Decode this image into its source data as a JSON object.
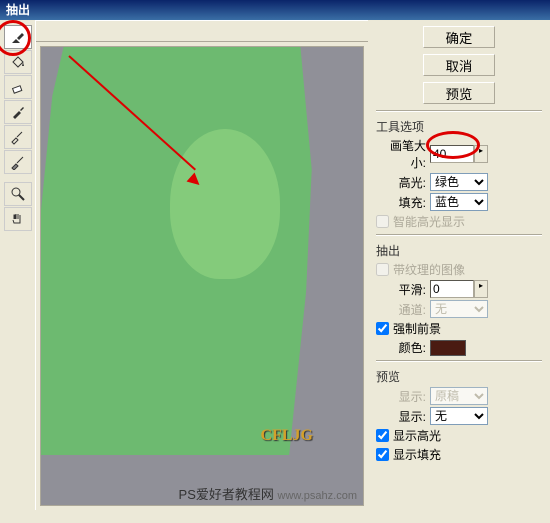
{
  "title": "抽出",
  "buttons": {
    "ok": "确定",
    "cancel": "取消",
    "preview": "预览"
  },
  "tool_options": {
    "title": "工具选项",
    "brush_size_label": "画笔大小:",
    "brush_size": "40",
    "highlight_label": "高光:",
    "highlight": "绿色",
    "fill_label": "填充:",
    "fill": "蓝色",
    "smart_highlight": "智能高光显示"
  },
  "extract": {
    "title": "抽出",
    "textured_label": "带纹理的图像",
    "smooth_label": "平滑:",
    "smooth": "0",
    "channel_label": "通道:",
    "channel": "无",
    "force_fg": "强制前景",
    "color_label": "颜色:",
    "color_hex": "#4a1b12"
  },
  "preview": {
    "title": "预览",
    "display_src_label": "显示:",
    "display_src": "原稿",
    "display_label": "显示:",
    "display": "无",
    "show_highlight": "显示高光",
    "show_fill": "显示填充"
  },
  "footer": {
    "watermark": "PS爱好者教程网",
    "url": "www.psahz.com",
    "wm_text": "CFLJG"
  }
}
